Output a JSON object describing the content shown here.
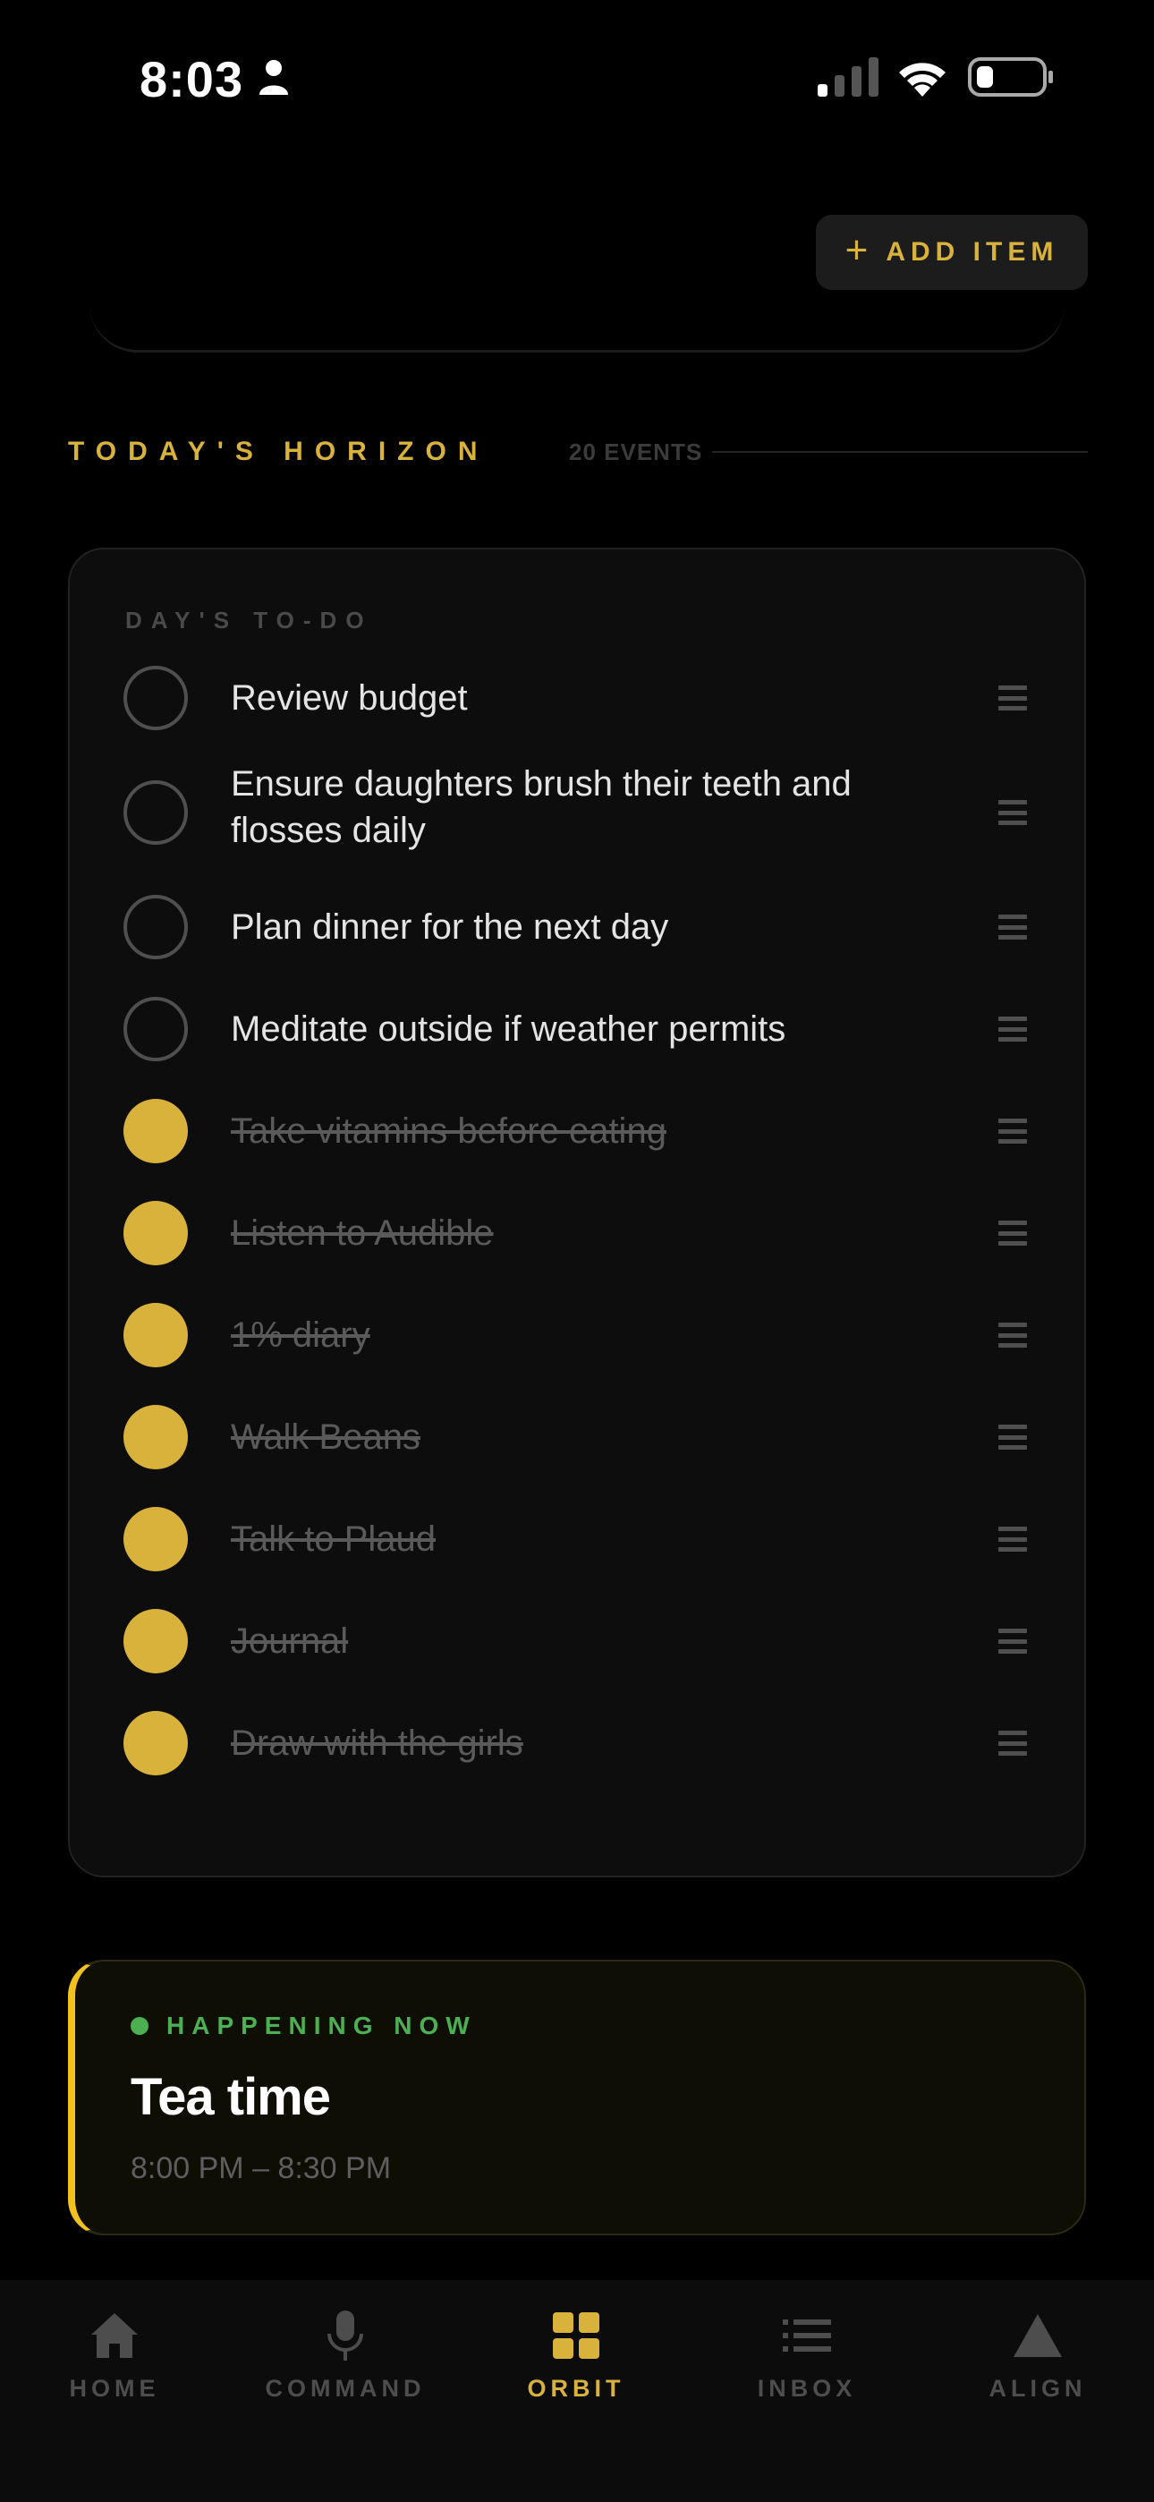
{
  "status_bar": {
    "time": "8:03"
  },
  "toolbar": {
    "add_item_label": "ADD ITEM"
  },
  "horizon": {
    "title": "TODAY'S HORIZON",
    "count": "20 EVENTS"
  },
  "todo_card": {
    "label": "DAY'S TO-DO",
    "items": [
      {
        "text": "Review budget",
        "done": false
      },
      {
        "text": "Ensure daughters brush their teeth and flosses daily",
        "done": false
      },
      {
        "text": "Plan dinner for the next day",
        "done": false
      },
      {
        "text": "Meditate outside if weather permits",
        "done": false
      },
      {
        "text": "Take vitamins before eating",
        "done": true
      },
      {
        "text": "Listen to Audible",
        "done": true
      },
      {
        "text": "1% diary",
        "done": true
      },
      {
        "text": "Walk Beans",
        "done": true
      },
      {
        "text": "Talk to Plaud",
        "done": true
      },
      {
        "text": "Journal",
        "done": true
      },
      {
        "text": "Draw with the girls",
        "done": true
      }
    ]
  },
  "now": {
    "label": "HAPPENING NOW",
    "title": "Tea time",
    "time": "8:00 PM – 8:30 PM"
  },
  "nav": {
    "items": [
      {
        "label": "HOME",
        "icon": "home-icon"
      },
      {
        "label": "COMMAND",
        "icon": "microphone-icon"
      },
      {
        "label": "ORBIT",
        "icon": "grid-icon",
        "active": true
      },
      {
        "label": "INBOX",
        "icon": "list-icon"
      },
      {
        "label": "ALIGN",
        "icon": "triangle-icon"
      }
    ]
  },
  "colors": {
    "accent": "#d9b23c",
    "live": "#4caf50",
    "background": "#000000",
    "card": "#0d0d0d"
  }
}
